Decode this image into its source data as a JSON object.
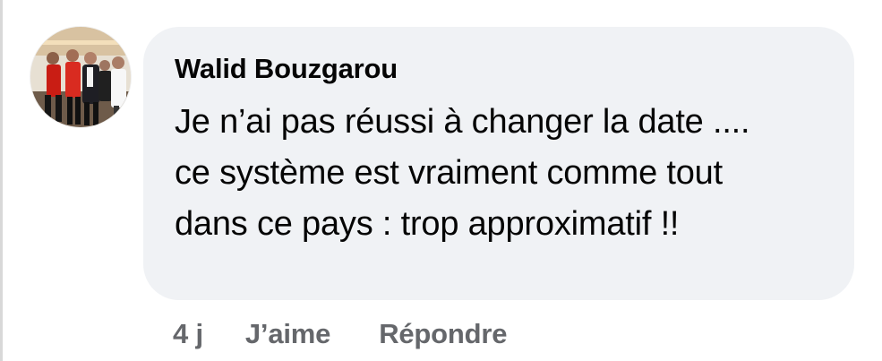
{
  "comment": {
    "author": "Walid Bouzgarou",
    "text": "Je n’ai pas réussi à changer la date .... ce système est vraiment comme tout dans ce pays : trop approximatif !!",
    "time": "4 j",
    "like_label": "J’aime",
    "reply_label": "Répondre"
  },
  "colors": {
    "bubble": "#f0f2f5",
    "text": "#050505",
    "secondary_text": "#65676b"
  },
  "avatar": {
    "icon": "profile-photo"
  }
}
